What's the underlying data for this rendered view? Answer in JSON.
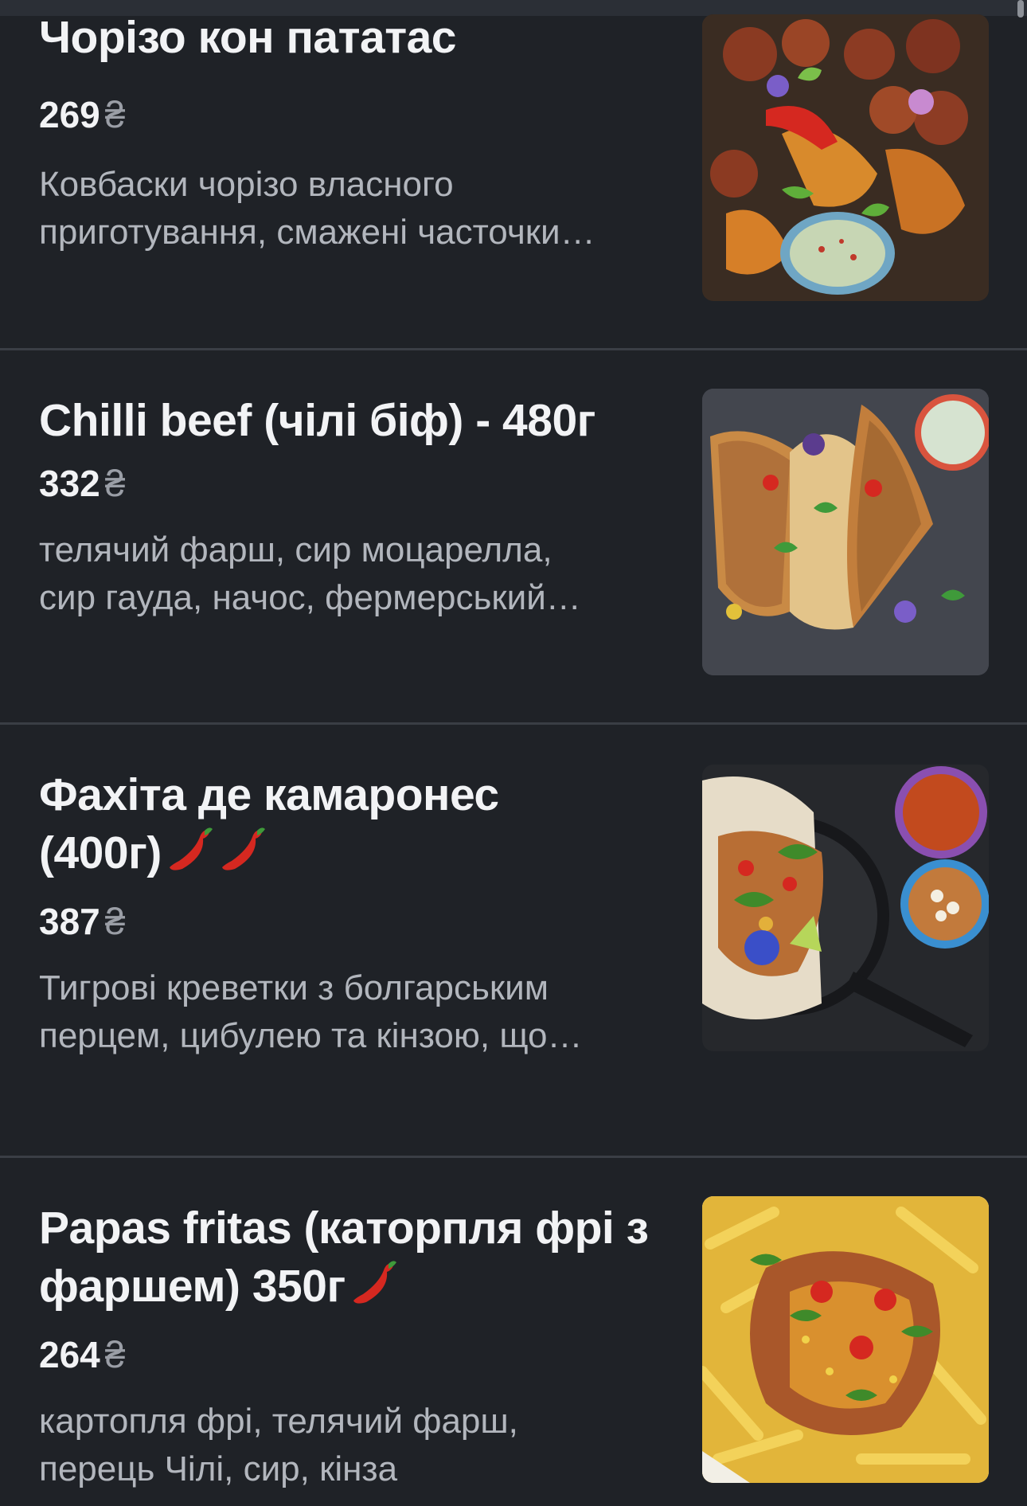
{
  "menu": {
    "currency": "₴",
    "items": [
      {
        "title": "Чорізо кон пататас",
        "price": "269",
        "description_line1": "Ковбаски чорізо власного",
        "description_line2": "приготування, смажені часточки…",
        "photo": "chorizo-potatoes-photo",
        "chili_count": 0
      },
      {
        "title": "Chilli beef (чілі біф) - 480г",
        "price": "332",
        "description_line1": "телячий фарш, сир моцарелла,",
        "description_line2": "сир гауда, начос, фермерський…",
        "photo": "quesadilla-photo",
        "chili_count": 0
      },
      {
        "title_line1": "Фахіта де камаронес",
        "title_line2": "(400г)",
        "price": "387",
        "description_line1": "Тигрові креветки з болгарським",
        "description_line2": "перцем, цибулею та кінзою, що…",
        "photo": "fajita-pan-photo",
        "chili_count": 2
      },
      {
        "title_line1": "Papas fritas (каторпля фрі з",
        "title_line2": "фаршем) 350г",
        "price": "264",
        "description_line1": "картопля фрі, телячий фарш,",
        "description_line2": "перець Чілі, сир, кінза",
        "photo": "loaded-fries-photo",
        "chili_count": 1
      }
    ]
  },
  "colors": {
    "background": "#1f2227",
    "divider": "#3a3e45",
    "title": "#f2f3f5",
    "description": "#b2b6bd",
    "currency": "#9a9ea6"
  }
}
